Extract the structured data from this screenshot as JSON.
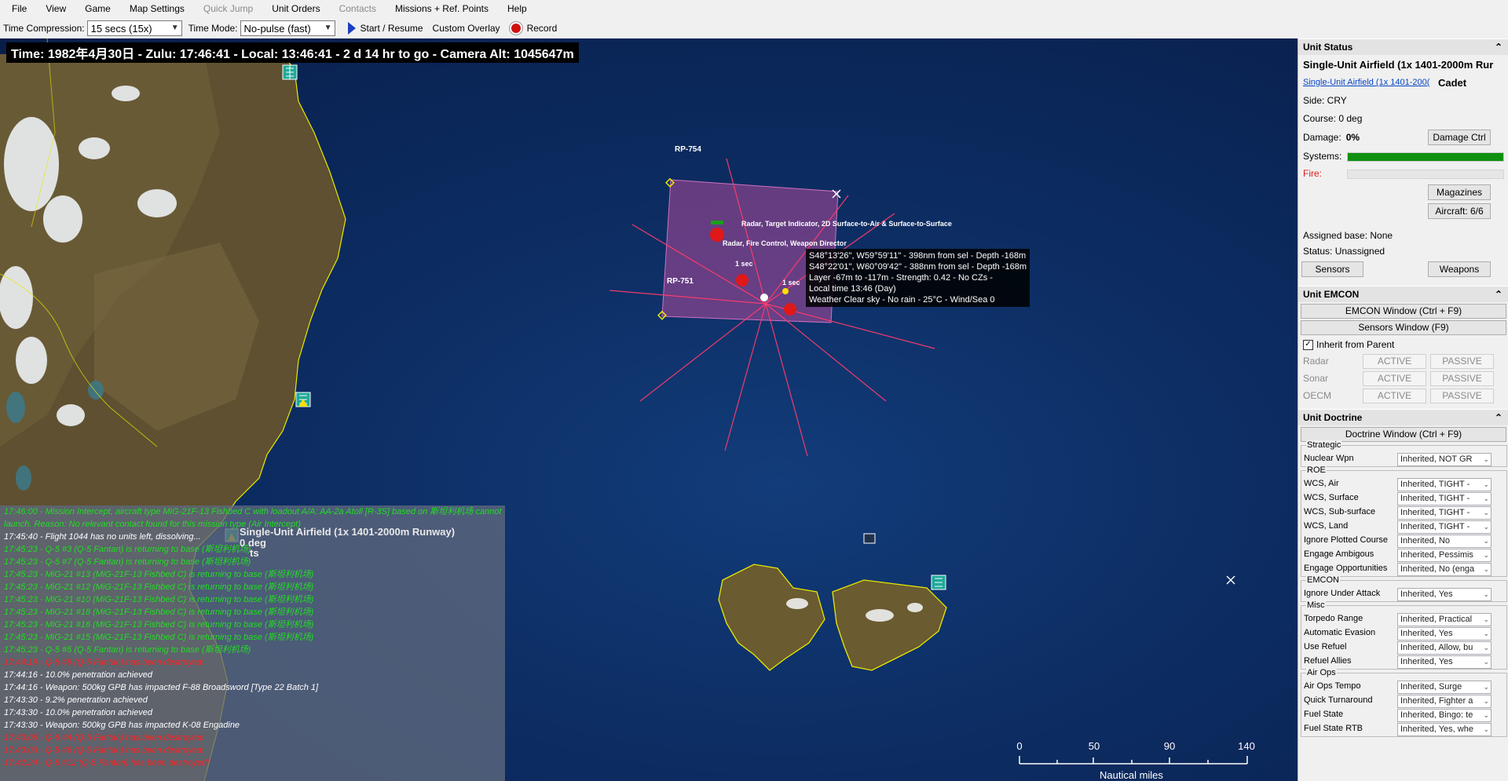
{
  "menu": {
    "items": [
      {
        "label": "File",
        "enabled": true
      },
      {
        "label": "View",
        "enabled": true
      },
      {
        "label": "Game",
        "enabled": true
      },
      {
        "label": "Map Settings",
        "enabled": true
      },
      {
        "label": "Quick Jump",
        "enabled": false
      },
      {
        "label": "Unit Orders",
        "enabled": true
      },
      {
        "label": "Contacts",
        "enabled": false
      },
      {
        "label": "Missions + Ref. Points",
        "enabled": true
      },
      {
        "label": "Help",
        "enabled": true
      }
    ]
  },
  "toolbar": {
    "time_compression_label": "Time Compression:",
    "time_compression_value": "15 secs (15x)",
    "time_mode_label": "Time Mode:",
    "time_mode_value": "No-pulse (fast)",
    "start_resume_label": "Start / Resume",
    "custom_overlay_label": "Custom Overlay",
    "record_label": "Record"
  },
  "map": {
    "time_bar": "Time: 1982年4月30日 - Zulu: 17:46:41 - Local: 13:46:41 - 2 d 14 hr to go -  Camera Alt: 1045647m",
    "ref_points": [
      "RP-754",
      "RP-751"
    ],
    "selected_unit_label": "Single-Unit Airfield (1x 1401-2000m Runway)",
    "selected_unit_sub1": "0 deg",
    "selected_unit_sub2": "ts",
    "contact_labels": [
      "Radar, Target Indicator, 2D Surface-to-Air & Surface-to-Surface",
      "Radar, Fire Control, Weapon Director",
      "1 sec",
      "1 sec"
    ],
    "popup_lines": [
      "S48°13'26\", W59°59'11\" - 398nm from sel - Depth -168m",
      "S48°22'01\", W60°09'42\" - 388nm from sel - Depth -168m",
      "Layer -67m to -117m - Strength: 0.42 - No CZs -",
      "Local time 13:46 (Day)",
      "Weather Clear sky - No rain - 25°C - Wind/Sea 0"
    ],
    "scale": {
      "ticks": [
        "0",
        "50",
        "90",
        "140"
      ],
      "unit": "Nautical miles"
    }
  },
  "message_log": [
    {
      "color": "green",
      "text": "17:46:00 - Mission Intercept, aircraft type MiG-21F-13 Fishbed C with loadout A/A: AA-2a Atoll [R-3S] based on 斯坦利机场 cannot"
    },
    {
      "color": "green",
      "text": "launch. Reason: No relevant contact found for this mission type (Air Intercept)"
    },
    {
      "color": "white",
      "text": "17:45:40 - Flight 1044 has no units left, dissolving..."
    },
    {
      "color": "green",
      "text": "17:45:23 - Q-5 #3 (Q-5 Fantan) is returning to base (斯坦利机场)"
    },
    {
      "color": "green",
      "text": "17:45:23 - Q-5 #7 (Q-5 Fantan) is returning to base (斯坦利机场)"
    },
    {
      "color": "green",
      "text": "17:45:23 - MiG-21 #13 (MiG-21F-13 Fishbed C) is returning to base (斯坦利机场)"
    },
    {
      "color": "green",
      "text": "17:45:23 - MiG-21 #12 (MiG-21F-13 Fishbed C) is returning to base (斯坦利机场)"
    },
    {
      "color": "green",
      "text": "17:45:23 - MiG-21 #10 (MiG-21F-13 Fishbed C) is returning to base (斯坦利机场)"
    },
    {
      "color": "green",
      "text": "17:45:23 - MiG-21 #18 (MiG-21F-13 Fishbed C) is returning to base (斯坦利机场)"
    },
    {
      "color": "green",
      "text": "17:45:23 - MiG-21 #16 (MiG-21F-13 Fishbed C) is returning to base (斯坦利机场)"
    },
    {
      "color": "green",
      "text": "17:45:23 - MiG-21 #15 (MiG-21F-13 Fishbed C) is returning to base (斯坦利机场)"
    },
    {
      "color": "green",
      "text": "17:45:23 - Q-5 #5 (Q-5 Fantan) is returning to base (斯坦利机场)"
    },
    {
      "color": "red",
      "text": "17:44:19 - Q-5 #9 (Q-5 Fantan) has been destroyed!"
    },
    {
      "color": "white",
      "text": "17:44:16 - 10.0% penetration achieved"
    },
    {
      "color": "white",
      "text": "17:44:16 - Weapon: 500kg GPB has impacted F-88 Broadsword [Type 22 Batch 1]"
    },
    {
      "color": "white",
      "text": "17:43:30 - 9.2% penetration achieved"
    },
    {
      "color": "white",
      "text": "17:43:30 - 10.0% penetration achieved"
    },
    {
      "color": "white",
      "text": "17:43:30 - Weapon: 500kg GPB has impacted K-08 Engadine"
    },
    {
      "color": "red",
      "text": "17:43:05 - Q-5 #4 (Q-5 Fantan) has been destroyed!"
    },
    {
      "color": "red",
      "text": "17:43:03 - Q-5 #6 (Q-5 Fantan) has been destroyed!"
    },
    {
      "color": "red",
      "text": "17:42:24 - Q-5 #12 (Q-5 Fantan) has been destroyed!"
    }
  ],
  "unit_status": {
    "header": "Unit Status",
    "name": "Single-Unit Airfield (1x 1401-2000m Rur",
    "link": "Single-Unit Airfield (1x 1401-200(",
    "proficiency": "Cadet",
    "side": "Side: CRY",
    "course": "Course: 0 deg",
    "damage_label": "Damage:",
    "damage_value": "0%",
    "damage_ctrl": "Damage Ctrl",
    "systems_label": "Systems:",
    "systems_fraction": 1.0,
    "fire_label": "Fire:",
    "fire_fraction": 0.0,
    "magazines": "Magazines",
    "aircraft": "Aircraft: 6/6",
    "assigned_base": "Assigned base: None",
    "status": "Status: Unassigned",
    "sensors": "Sensors",
    "weapons": "Weapons"
  },
  "unit_emcon": {
    "header": "Unit EMCON",
    "emcon_window": "EMCON Window (Ctrl + F9)",
    "sensors_window": "Sensors Window (F9)",
    "inherit_label": "Inherit from Parent",
    "inherit_checked": true,
    "rows": [
      {
        "name": "Radar",
        "active": "ACTIVE",
        "passive": "PASSIVE"
      },
      {
        "name": "Sonar",
        "active": "ACTIVE",
        "passive": "PASSIVE"
      },
      {
        "name": "OECM",
        "active": "ACTIVE",
        "passive": "PASSIVE"
      }
    ]
  },
  "unit_doctrine": {
    "header": "Unit Doctrine",
    "doctrine_window": "Doctrine Window (Ctrl + F9)",
    "groups": [
      {
        "title": "Strategic",
        "rows": [
          {
            "name": "Nuclear Wpn",
            "value": "Inherited, NOT GR"
          }
        ]
      },
      {
        "title": "ROE",
        "rows": [
          {
            "name": "WCS, Air",
            "value": "Inherited, TIGHT -"
          },
          {
            "name": "WCS, Surface",
            "value": "Inherited, TIGHT -"
          },
          {
            "name": "WCS, Sub-surface",
            "value": "Inherited, TIGHT -"
          },
          {
            "name": "WCS, Land",
            "value": "Inherited, TIGHT -"
          },
          {
            "name": "Ignore Plotted Course",
            "value": "Inherited, No"
          },
          {
            "name": "Engage Ambigous",
            "value": "Inherited, Pessimis"
          },
          {
            "name": "Engage Opportunities",
            "value": "Inherited, No (enga"
          }
        ]
      },
      {
        "title": "EMCON",
        "rows": [
          {
            "name": "Ignore Under Attack",
            "value": "Inherited, Yes"
          }
        ]
      },
      {
        "title": "Misc",
        "rows": [
          {
            "name": "Torpedo Range",
            "value": "Inherited, Practical"
          },
          {
            "name": "Automatic Evasion",
            "value": "Inherited, Yes"
          },
          {
            "name": "Use Refuel",
            "value": "Inherited, Allow, bu"
          },
          {
            "name": "Refuel Allies",
            "value": "Inherited, Yes"
          }
        ]
      },
      {
        "title": "Air Ops",
        "rows": [
          {
            "name": "Air Ops Tempo",
            "value": "Inherited, Surge"
          },
          {
            "name": "Quick Turnaround",
            "value": "Inherited, Fighter a"
          },
          {
            "name": "Fuel State",
            "value": "Inherited, Bingo: te"
          },
          {
            "name": "Fuel State RTB",
            "value": "Inherited, Yes, whe"
          }
        ]
      }
    ]
  },
  "colors": {
    "systems": "#109010",
    "log_green": "#22dd22",
    "log_red": "#ff2020",
    "coast": "#e8e800",
    "emitter": "#ff3b6b"
  }
}
